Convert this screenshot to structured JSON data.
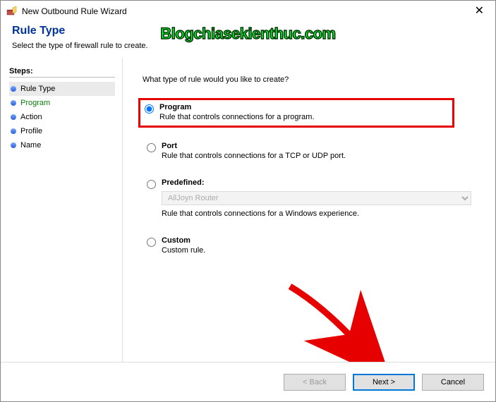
{
  "window": {
    "title": "New Outbound Rule Wizard"
  },
  "watermark": "Blogchiasekienthuc.com",
  "header": {
    "title": "Rule Type",
    "subtitle": "Select the type of firewall rule to create."
  },
  "sidebar": {
    "label": "Steps:",
    "items": [
      {
        "label": "Rule Type"
      },
      {
        "label": "Program"
      },
      {
        "label": "Action"
      },
      {
        "label": "Profile"
      },
      {
        "label": "Name"
      }
    ]
  },
  "content": {
    "prompt": "What type of rule would you like to create?",
    "options": {
      "program": {
        "title": "Program",
        "desc": "Rule that controls connections for a program."
      },
      "port": {
        "title": "Port",
        "desc": "Rule that controls connections for a TCP or UDP port."
      },
      "predefined": {
        "title": "Predefined:",
        "select_value": "AllJoyn Router",
        "desc": "Rule that controls connections for a Windows experience."
      },
      "custom": {
        "title": "Custom",
        "desc": "Custom rule."
      }
    }
  },
  "footer": {
    "back": "< Back",
    "next": "Next >",
    "cancel": "Cancel"
  }
}
